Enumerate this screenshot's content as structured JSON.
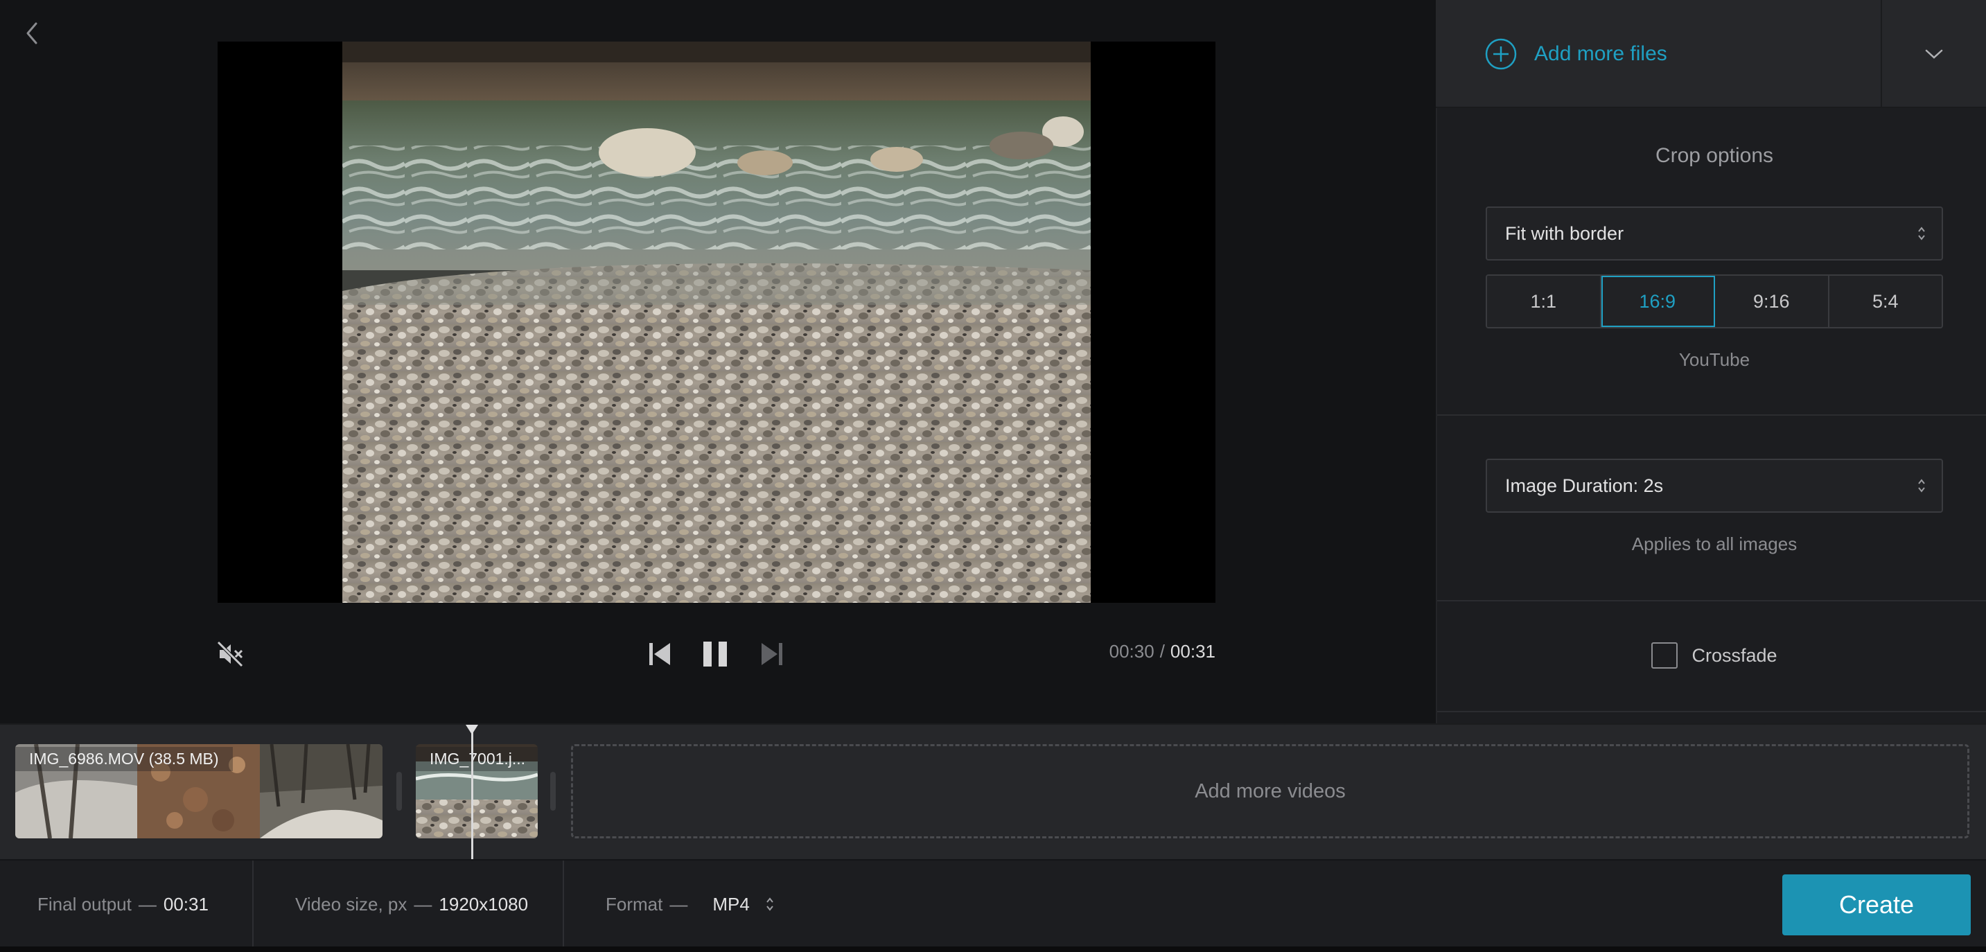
{
  "player": {
    "time_current": "00:30",
    "time_separator": "/",
    "time_total": "00:31",
    "muted": true,
    "playing": true
  },
  "right_panel": {
    "add_files_label": "Add more files",
    "crop": {
      "title": "Crop options",
      "mode_value": "Fit with border",
      "ratios": [
        "1:1",
        "16:9",
        "9:16",
        "5:4"
      ],
      "selected_ratio": "16:9",
      "ratio_caption": "YouTube"
    },
    "duration": {
      "value": "Image Duration: 2s",
      "caption": "Applies to all images"
    },
    "crossfade": {
      "label": "Crossfade",
      "checked": false
    }
  },
  "timeline": {
    "clips": [
      {
        "label": "IMG_6986.MOV (38.5 MB)"
      },
      {
        "label": "IMG_7001.j..."
      }
    ],
    "add_more_label": "Add more videos"
  },
  "footer": {
    "final_output_label": "Final output",
    "final_output_value": "00:31",
    "video_size_label": "Video size, px",
    "video_size_value": "1920x1080",
    "format_label": "Format",
    "format_value": "MP4",
    "dash": "—",
    "create_label": "Create"
  },
  "colors": {
    "accent": "#1fa0c3",
    "create_button": "#1c93b3",
    "background": "#131416",
    "panel": "#1c1d20"
  },
  "icons": [
    "chevron-left-icon",
    "add-circle-icon",
    "chevron-down-icon",
    "sort-arrows-icon",
    "speaker-muted-icon",
    "skip-back-icon",
    "pause-icon",
    "skip-forward-icon",
    "playhead-icon"
  ]
}
